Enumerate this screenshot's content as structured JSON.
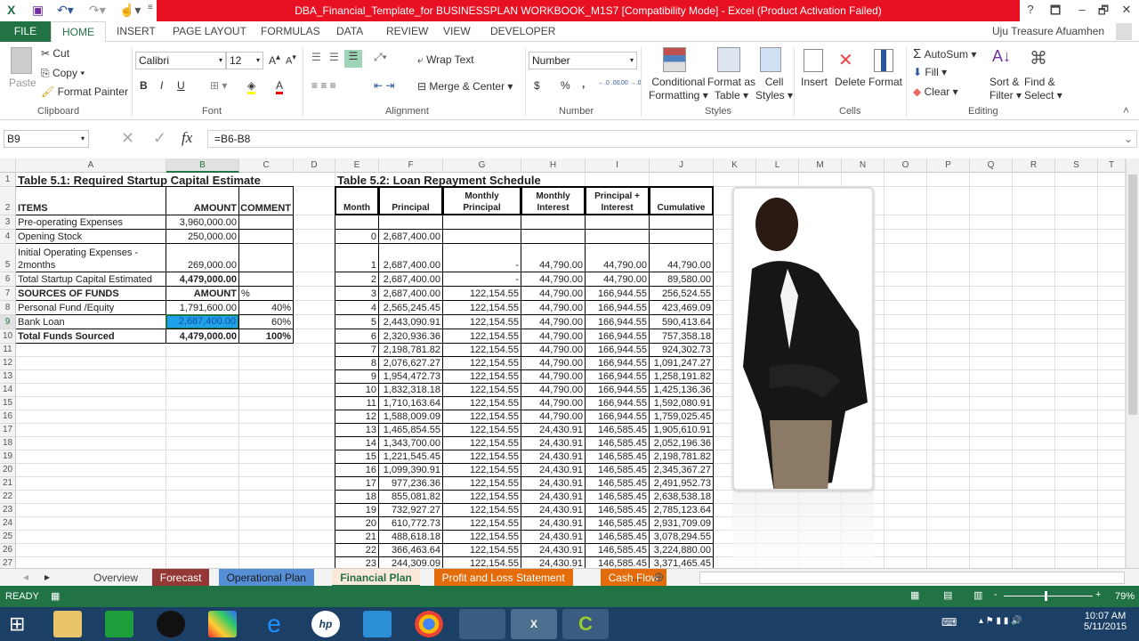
{
  "window": {
    "title": "DBA_Financial_Template_for BUSINESSPLAN WORKBOOK_M1S7  [Compatibility Mode] -  Excel (Product Activation Failed)",
    "help": "?",
    "restore": "🗗",
    "minimize": "–",
    "maximize": "🗖",
    "close": "✕",
    "user": "Uju Treasure Afuamhen"
  },
  "ribbon_tabs": [
    "FILE",
    "HOME",
    "INSERT",
    "PAGE LAYOUT",
    "FORMULAS",
    "DATA",
    "REVIEW",
    "VIEW",
    "DEVELOPER"
  ],
  "ribbon": {
    "clipboard": {
      "paste": "Paste",
      "cut": "Cut",
      "copy": "Copy",
      "format_painter": "Format Painter",
      "label": "Clipboard"
    },
    "font": {
      "name": "Calibri",
      "size": "12",
      "bold": "B",
      "italic": "I",
      "underline": "U",
      "label": "Font"
    },
    "alignment": {
      "wrap": "Wrap Text",
      "merge": "Merge & Center",
      "label": "Alignment"
    },
    "number": {
      "format": "Number",
      "currency": "$",
      "percent": "%",
      "comma": ",",
      "inc": "←.0 .00",
      "dec": ".00 →.0",
      "label": "Number"
    },
    "styles": {
      "conditional": "Conditional",
      "conditional2": "Formatting",
      "format_table": "Format as",
      "format_table2": "Table",
      "cell_styles": "Cell",
      "cell_styles2": "Styles",
      "label": "Styles"
    },
    "cells": {
      "insert": "Insert",
      "delete": "Delete",
      "format": "Format",
      "label": "Cells"
    },
    "editing": {
      "autosum": "AutoSum",
      "fill": "Fill",
      "clear": "Clear",
      "sort": "Sort &",
      "sort2": "Filter",
      "find": "Find &",
      "find2": "Select",
      "label": "Editing"
    }
  },
  "formula_bar": {
    "name_box": "B9",
    "formula": "=B6-B8",
    "fx": "fx"
  },
  "columns": [
    "A",
    "B",
    "C",
    "D",
    "E",
    "F",
    "G",
    "H",
    "I",
    "J",
    "K",
    "L",
    "M",
    "N",
    "O",
    "P",
    "Q",
    "R",
    "S",
    "T"
  ],
  "selected_cell": "B9",
  "table51": {
    "title": "Table 5.1: Required Startup Capital Estimate",
    "rows": [
      [
        "ITEMS",
        "AMOUNT",
        "COMMENT"
      ],
      [
        "Pre-operating Expenses",
        "3,960,000.00",
        ""
      ],
      [
        "Opening Stock",
        "250,000.00",
        ""
      ],
      [
        "Initial Operating Expenses - 2months",
        "269,000.00",
        ""
      ],
      [
        "Total Startup Capital Estimated",
        "4,479,000.00",
        ""
      ],
      [
        "SOURCES  OF  FUNDS",
        "AMOUNT",
        "%"
      ],
      [
        "Personal Fund /Equity",
        "1,791,600.00",
        "40%"
      ],
      [
        "Bank Loan",
        "2,687,400.00",
        "60%"
      ],
      [
        "Total Funds Sourced",
        "4,479,000.00",
        "100%"
      ]
    ]
  },
  "table52": {
    "title": "Table 5.2: Loan Repayment Schedule",
    "headers": [
      "Month",
      "Principal",
      "Monthly Principal",
      "Monthly Interest",
      "Principal + Interest",
      "Cumulative"
    ],
    "rows": [
      [
        "",
        "",
        "",
        "",
        "",
        ""
      ],
      [
        "0",
        "2,687,400.00",
        "",
        "",
        "",
        ""
      ],
      [
        "1",
        "2,687,400.00",
        "-",
        "44,790.00",
        "44,790.00",
        "44,790.00"
      ],
      [
        "2",
        "2,687,400.00",
        "-",
        "44,790.00",
        "44,790.00",
        "89,580.00"
      ],
      [
        "3",
        "2,687,400.00",
        "122,154.55",
        "44,790.00",
        "166,944.55",
        "256,524.55"
      ],
      [
        "4",
        "2,565,245.45",
        "122,154.55",
        "44,790.00",
        "166,944.55",
        "423,469.09"
      ],
      [
        "5",
        "2,443,090.91",
        "122,154.55",
        "44,790.00",
        "166,944.55",
        "590,413.64"
      ],
      [
        "6",
        "2,320,936.36",
        "122,154.55",
        "44,790.00",
        "166,944.55",
        "757,358.18"
      ],
      [
        "7",
        "2,198,781.82",
        "122,154.55",
        "44,790.00",
        "166,944.55",
        "924,302.73"
      ],
      [
        "8",
        "2,076,627.27",
        "122,154.55",
        "44,790.00",
        "166,944.55",
        "1,091,247.27"
      ],
      [
        "9",
        "1,954,472.73",
        "122,154.55",
        "44,790.00",
        "166,944.55",
        "1,258,191.82"
      ],
      [
        "10",
        "1,832,318.18",
        "122,154.55",
        "44,790.00",
        "166,944.55",
        "1,425,136.36"
      ],
      [
        "11",
        "1,710,163.64",
        "122,154.55",
        "44,790.00",
        "166,944.55",
        "1,592,080.91"
      ],
      [
        "12",
        "1,588,009.09",
        "122,154.55",
        "44,790.00",
        "166,944.55",
        "1,759,025.45"
      ],
      [
        "13",
        "1,465,854.55",
        "122,154.55",
        "24,430.91",
        "146,585.45",
        "1,905,610.91"
      ],
      [
        "14",
        "1,343,700.00",
        "122,154.55",
        "24,430.91",
        "146,585.45",
        "2,052,196.36"
      ],
      [
        "15",
        "1,221,545.45",
        "122,154.55",
        "24,430.91",
        "146,585.45",
        "2,198,781.82"
      ],
      [
        "16",
        "1,099,390.91",
        "122,154.55",
        "24,430.91",
        "146,585.45",
        "2,345,367.27"
      ],
      [
        "17",
        "977,236.36",
        "122,154.55",
        "24,430.91",
        "146,585.45",
        "2,491,952.73"
      ],
      [
        "18",
        "855,081.82",
        "122,154.55",
        "24,430.91",
        "146,585.45",
        "2,638,538.18"
      ],
      [
        "19",
        "732,927.27",
        "122,154.55",
        "24,430.91",
        "146,585.45",
        "2,785,123.64"
      ],
      [
        "20",
        "610,772.73",
        "122,154.55",
        "24,430.91",
        "146,585.45",
        "2,931,709.09"
      ],
      [
        "21",
        "488,618.18",
        "122,154.55",
        "24,430.91",
        "146,585.45",
        "3,078,294.55"
      ],
      [
        "22",
        "366,463.64",
        "122,154.55",
        "24,430.91",
        "146,585.45",
        "3,224,880.00"
      ],
      [
        "23",
        "244,309.09",
        "122,154.55",
        "24,430.91",
        "146,585.45",
        "3,371,465.45"
      ]
    ]
  },
  "sheet_tabs": [
    {
      "label": "Overview",
      "color": "#f3f3f3",
      "text": "#444"
    },
    {
      "label": "Forecast",
      "color": "#953735",
      "text": "#fff"
    },
    {
      "label": "Operational Plan",
      "color": "#558ed5",
      "text": "#1a1a1a"
    },
    {
      "label": "Financial Plan",
      "color": "#fde9d9",
      "text": "#217346",
      "active": true
    },
    {
      "label": "Profit and Loss Statement",
      "color": "#e46c0a",
      "text": "#fff"
    },
    {
      "label": "Cash Flow",
      "color": "#e46c0a",
      "text": "#fff"
    }
  ],
  "sheet_more": "...",
  "status": {
    "ready": "READY",
    "zoom": "79%",
    "zoom_level": 79
  },
  "taskbar": {
    "time": "10:07 AM",
    "date": "5/11/2015"
  },
  "colors": {
    "excel_green": "#217346",
    "title_red": "#e81123",
    "selection": "#1fa2ea",
    "taskbar": "#1c3f66"
  }
}
